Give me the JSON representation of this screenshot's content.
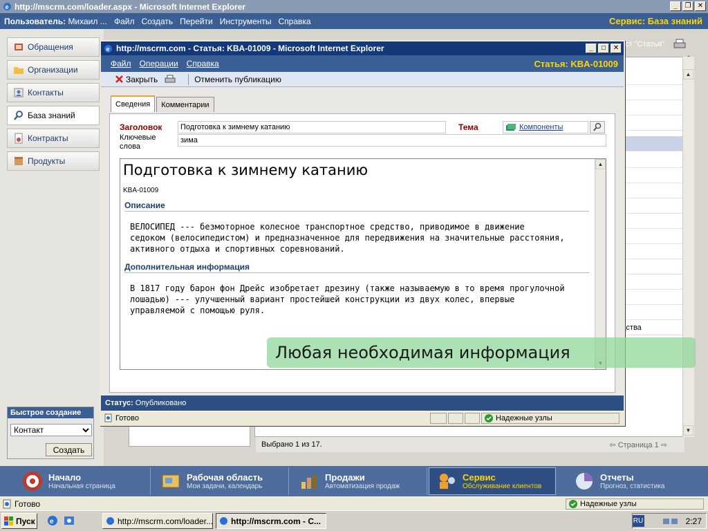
{
  "window": {
    "title": "http://mscrm.com/loader.aspx - Microsoft Internet Explorer"
  },
  "menubar": {
    "user_label": "Пользователь:",
    "user_name": "Михаил ...",
    "items": [
      "Файл",
      "Создать",
      "Перейти",
      "Инструменты",
      "Справка"
    ],
    "service_title": "Сервис: База знаний"
  },
  "nav": {
    "items": [
      {
        "label": "Обращения",
        "icon": "cases-icon"
      },
      {
        "label": "Организации",
        "icon": "folder-icon"
      },
      {
        "label": "Контакты",
        "icon": "contacts-icon"
      },
      {
        "label": "База знаний",
        "icon": "magnifier-icon",
        "selected": true
      },
      {
        "label": "Контракты",
        "icon": "contract-icon"
      },
      {
        "label": "Продукты",
        "icon": "product-icon"
      }
    ]
  },
  "quick_create": {
    "title": "Быстрое создание",
    "selected": "Контакт",
    "button": "Создать"
  },
  "background": {
    "print_label": "ст \"Статья\"",
    "partial_row_text": "дства",
    "footer_selected": "Выбрано 1 из 17.",
    "footer_page": "Страница 1"
  },
  "wunderbar": [
    {
      "title": "Начало",
      "subtitle": "Начальная страница"
    },
    {
      "title": "Рабочая область",
      "subtitle": "Мои задачи, календарь"
    },
    {
      "title": "Продажи",
      "subtitle": "Автоматизация продаж"
    },
    {
      "title": "Сервис",
      "subtitle": "Обслуживание клиентов",
      "selected": true
    },
    {
      "title": "Отчеты",
      "subtitle": "Прогноз, статистика"
    }
  ],
  "outer_status": {
    "text": "Готово",
    "zone": "Надежные узлы"
  },
  "taskbar": {
    "start": "Пуск",
    "buttons": [
      "http://mscrm.com/loader....",
      "http://mscrm.com - С..."
    ],
    "lang": "RU",
    "time": "2:27"
  },
  "popup": {
    "title": "http://mscrm.com - Статья: KBA-01009 - Microsoft Internet Explorer",
    "menu": [
      "Файл",
      "Операции",
      "Справка"
    ],
    "article_title": "Статья: KBA-01009",
    "toolbar": {
      "close": "Закрыть",
      "unpublish": "Отменить публикацию"
    },
    "tabs": [
      "Сведения",
      "Комментарии"
    ],
    "form": {
      "title_label": "Заголовок",
      "title_value": "Подготовка к зимнему катанию",
      "subject_label": "Тема",
      "subject_value": "Компоненты",
      "keywords_label_1": "Ключевые",
      "keywords_label_2": "слова",
      "keywords_value": "зима"
    },
    "article": {
      "heading": "Подготовка к зимнему катанию",
      "id": "KBA-01009",
      "section1_title": "Описание",
      "section1_lines": [
        "ВЕЛОСИПЕД --- безмоторное колесное транспортное средство, приводимое в движение",
        "седоком (велосипедистом) и предназначенное для передвижения на значительные расстояния,",
        "активного отдыха и спортивных соревнований."
      ],
      "section2_title": "Дополнительная информация",
      "section2_lines": [
        "В 1817 году барон фон Дрейс изобретает дрезину (также называемую в то время прогулочной",
        "лошадью) --- улучшенный вариант простейшей конструкции из двух колес, впервые",
        "управляемой с помощью руля."
      ]
    },
    "status_label": "Статус:",
    "status_value": "Опубликовано",
    "ie_status": "Готово",
    "ie_zone": "Надежные узлы"
  },
  "callout": {
    "text": "Любая необходимая информация"
  },
  "colors": {
    "crm_blue": "#3a5f94",
    "title_yellow": "#ffd700",
    "required_red": "#8b0000",
    "callout_green": "#8cd696"
  }
}
